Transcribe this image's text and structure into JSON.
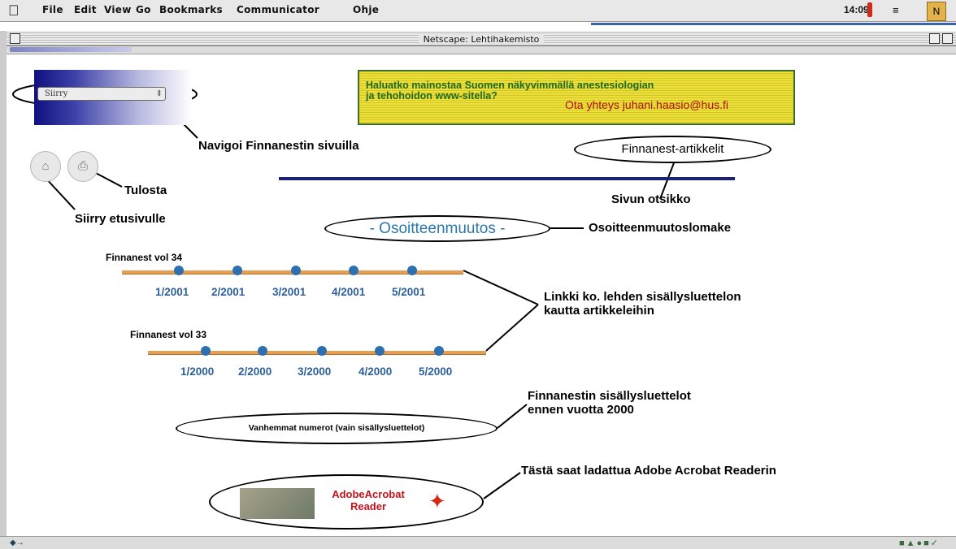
{
  "menubar": {
    "items": [
      "File",
      "Edit",
      "View",
      "Go",
      "Bookmarks",
      "Communicator",
      "Ohje"
    ],
    "clock": "14:09"
  },
  "window": {
    "title": "Netscape: Lehtihakemisto"
  },
  "page": {
    "nav_select_value": "Siirry",
    "ad": {
      "line1": "Haluatko mainostaa Suomen näkyvimmällä anestesiologian",
      "line2": "ja tehohoidon www-sitella?",
      "line3": "Ota yhteys juhani.haasio@hus.fi"
    },
    "article_title": "Finnanest-artikkelit",
    "address_change_link": "- Osoitteenmuutos -",
    "older_issues_link": "Vanhemmat numerot (vain sisällysluettelot)",
    "acrobat": {
      "line1": "AdobeAcrobat",
      "line2": "Reader"
    },
    "vol34": {
      "label": "Finnanest vol 34",
      "issues": [
        "1/2001",
        "2/2001",
        "3/2001",
        "4/2001",
        "5/2001"
      ]
    },
    "vol33": {
      "label": "Finnanest vol 33",
      "issues": [
        "1/2000",
        "2/2000",
        "3/2000",
        "4/2000",
        "5/2000"
      ]
    }
  },
  "annotations": {
    "navigate": "Navigoi Finnanestin sivuilla",
    "print": "Tulosta",
    "home": "Siirry etusivulle",
    "page_title": "Sivun otsikko",
    "address_form": "Osoitteenmuutoslomake",
    "link_line1": "Linkki ko. lehden sisällysluettelon",
    "link_line2": "kautta artikkeleihin",
    "toc_line1": "Finnanestin sisällysluettelot",
    "toc_line2": "ennen vuotta 2000",
    "acrobat_hint": "Tästä saat ladattua Adobe Acrobat Readerin"
  },
  "colors": {
    "accent_blue": "#2e6fb0",
    "track_orange": "#e3a054",
    "rule_navy": "#1d2270"
  }
}
